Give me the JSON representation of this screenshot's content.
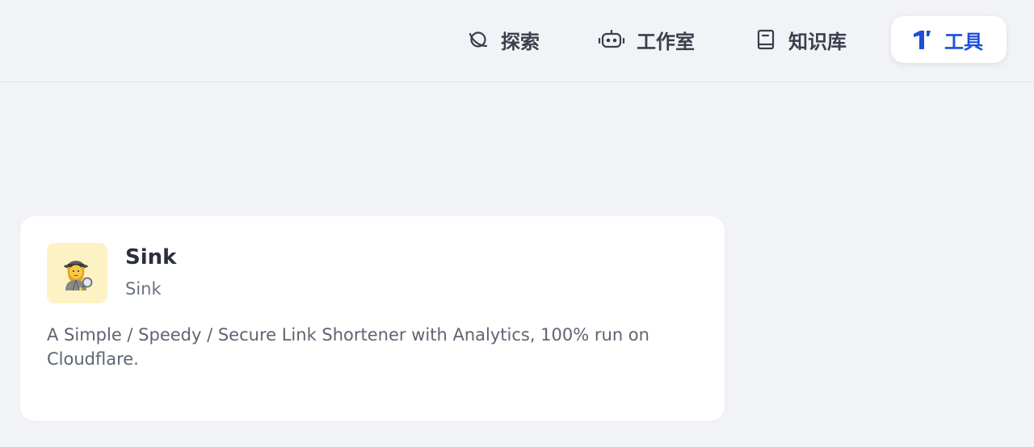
{
  "nav": {
    "items": [
      {
        "label": "探索",
        "icon": "planet-icon"
      },
      {
        "label": "工作室",
        "icon": "robot-icon"
      },
      {
        "label": "知识库",
        "icon": "book-icon"
      },
      {
        "label": "工具",
        "icon": "tool-logo-icon",
        "active": true
      }
    ]
  },
  "tool_card": {
    "emoji": "🕵️‍♀️",
    "title": "Sink",
    "subtitle": "Sink",
    "description": "A Simple / Speedy / Secure Link Shortener with Analytics, 100% run on Cloudflare."
  },
  "colors": {
    "active": "#1d4fd8",
    "background": "#f2f3f7",
    "icon_bg": "#fdf2c4"
  }
}
